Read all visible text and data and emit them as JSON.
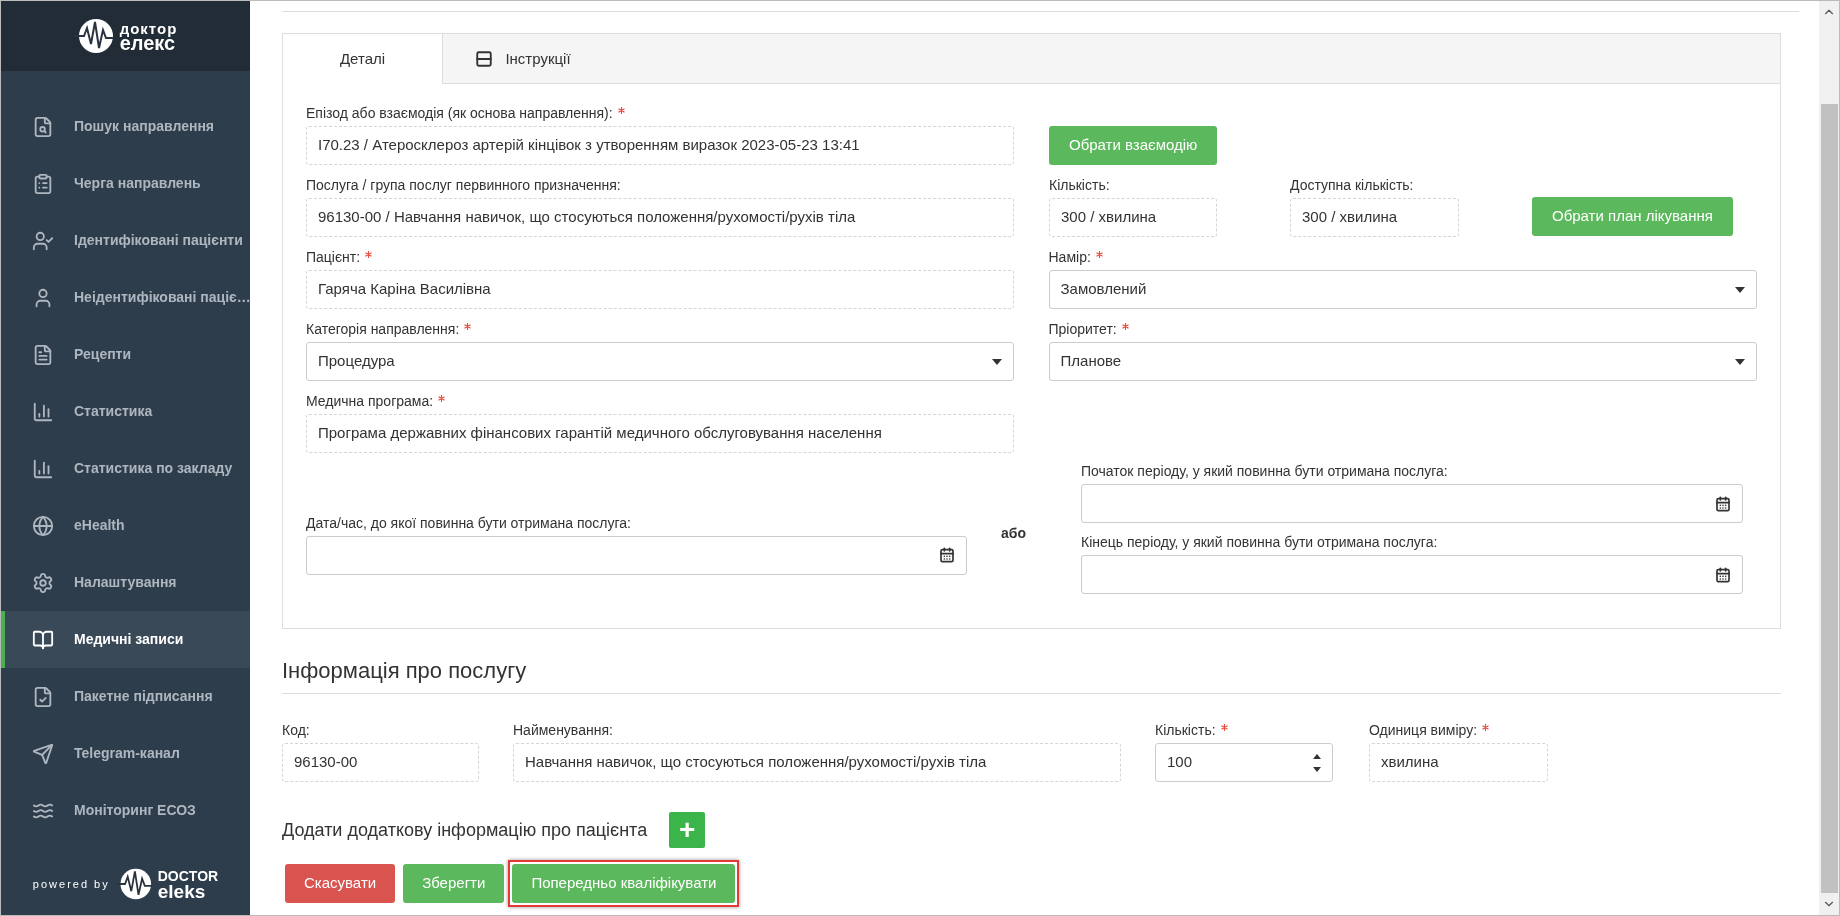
{
  "sidebar": {
    "logo": {
      "line1": "доктор",
      "line2": "елекс"
    },
    "items": [
      {
        "label": "Пошук направлення",
        "selected": false
      },
      {
        "label": "Черга направлень",
        "selected": false
      },
      {
        "label": "Ідентифіковані пацієнти",
        "selected": false
      },
      {
        "label": "Неідентифіковані паціє…",
        "selected": false
      },
      {
        "label": "Рецепти",
        "selected": false
      },
      {
        "label": "Статистика",
        "selected": false
      },
      {
        "label": "Статистика по закладу",
        "selected": false
      },
      {
        "label": "eHealth",
        "selected": false
      },
      {
        "label": "Налаштування",
        "selected": false
      },
      {
        "label": "Медичні записи",
        "selected": true
      },
      {
        "label": "Пакетне підписання",
        "selected": false
      },
      {
        "label": "Telegram-канал",
        "selected": false
      },
      {
        "label": "Моніторинг ЕСОЗ",
        "selected": false
      }
    ],
    "footer": {
      "powered": "powered by",
      "brand1": "DOCTOR",
      "brand2": "eleks"
    }
  },
  "tabs": [
    {
      "label": "Деталі",
      "selected": true
    },
    {
      "label": "Інструкції",
      "selected": false
    }
  ],
  "details": {
    "episode": {
      "label": "Епізод або взаємодія (як основа направлення):",
      "required": true,
      "value": "I70.23 / Атеросклероз артерій кінцівок з утворенням виразок 2023-05-23 13:41"
    },
    "choose_interaction": "Обрати взаємодію",
    "service": {
      "label": "Послуга / група послуг первинного призначення:",
      "required": false,
      "value": "96130-00 / Навчання навичок, що стосуються положення/рухомості/рухів тіла"
    },
    "quantity": {
      "label": "Кількість:",
      "required": false,
      "value": "300 / хвилина"
    },
    "available": {
      "label": "Доступна кількість:",
      "required": false,
      "value": "300 / хвилина"
    },
    "choose_plan": "Обрати план лікування",
    "patient": {
      "label": "Пацієнт:",
      "required": true,
      "value": "Гаряча Каріна Василівна"
    },
    "intent": {
      "label": "Намір:",
      "required": true,
      "value": "Замовлений"
    },
    "category": {
      "label": "Категорія направлення:",
      "required": true,
      "value": "Процедура"
    },
    "priority": {
      "label": "Пріоритет:",
      "required": true,
      "value": "Планове"
    },
    "program": {
      "label": "Медична програма:",
      "required": true,
      "value": "Програма державних фінансових гарантій медичного обслуговування населення"
    },
    "deadline": {
      "label": "Дата/час, до якої повинна бути отримана послуга:",
      "required": false
    },
    "or": "або",
    "period_start": {
      "label": "Початок періоду, у який повинна бути отримана послуга:",
      "required": false
    },
    "period_end": {
      "label": "Кінець періоду, у який повинна бути отримана послуга:",
      "required": false
    }
  },
  "service_info": {
    "title": "Інформація про послугу",
    "code": {
      "label": "Код:",
      "required": false,
      "value": "96130-00"
    },
    "name": {
      "label": "Найменування:",
      "required": false,
      "value": "Навчання навичок, що стосуються положення/рухомості/рухів тіла"
    },
    "amount": {
      "label": "Кількість:",
      "required": true,
      "value": "100"
    },
    "unit": {
      "label": "Одиниця виміру:",
      "required": true,
      "value": "хвилина"
    }
  },
  "add_info": {
    "label": "Додати додаткову інформацію про пацієнта",
    "button": "+"
  },
  "buttons": [
    {
      "label": "Скасувати",
      "kind": "danger",
      "highlighted": false
    },
    {
      "label": "Зберегти",
      "kind": "success",
      "highlighted": false
    },
    {
      "label": "Попередньо кваліфікувати",
      "kind": "success",
      "highlighted": true
    }
  ]
}
